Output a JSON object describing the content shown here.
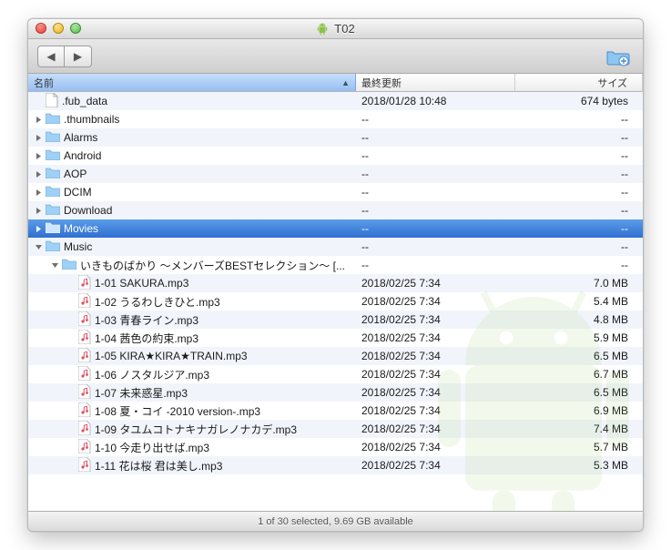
{
  "window": {
    "title": "T02"
  },
  "columns": {
    "name": "名前",
    "date": "最終更新",
    "size": "サイズ"
  },
  "status": "1 of 30 selected, 9.69 GB available",
  "rows": [
    {
      "indent": 0,
      "kind": "file",
      "expand": "",
      "name": ".fub_data",
      "date": "2018/01/28 10:48",
      "size": "674 bytes",
      "selected": false
    },
    {
      "indent": 0,
      "kind": "folder",
      "expand": "closed",
      "name": ".thumbnails",
      "date": "--",
      "size": "--",
      "selected": false
    },
    {
      "indent": 0,
      "kind": "folder",
      "expand": "closed",
      "name": "Alarms",
      "date": "--",
      "size": "--",
      "selected": false
    },
    {
      "indent": 0,
      "kind": "folder",
      "expand": "closed",
      "name": "Android",
      "date": "--",
      "size": "--",
      "selected": false
    },
    {
      "indent": 0,
      "kind": "folder",
      "expand": "closed",
      "name": "AOP",
      "date": "--",
      "size": "--",
      "selected": false
    },
    {
      "indent": 0,
      "kind": "folder",
      "expand": "closed",
      "name": "DCIM",
      "date": "--",
      "size": "--",
      "selected": false
    },
    {
      "indent": 0,
      "kind": "folder",
      "expand": "closed",
      "name": "Download",
      "date": "--",
      "size": "--",
      "selected": false
    },
    {
      "indent": 0,
      "kind": "folder",
      "expand": "closed",
      "name": "Movies",
      "date": "--",
      "size": "--",
      "selected": true
    },
    {
      "indent": 0,
      "kind": "folder",
      "expand": "open",
      "name": "Music",
      "date": "--",
      "size": "--",
      "selected": false
    },
    {
      "indent": 1,
      "kind": "folder",
      "expand": "open",
      "name": "いきものばかり ～メンバーズBESTセレクション～ [...",
      "date": "--",
      "size": "--",
      "selected": false
    },
    {
      "indent": 2,
      "kind": "music",
      "expand": "",
      "name": "1-01 SAKURA.mp3",
      "date": "2018/02/25 7:34",
      "size": "7.0 MB",
      "selected": false
    },
    {
      "indent": 2,
      "kind": "music",
      "expand": "",
      "name": "1-02 うるわしきひと.mp3",
      "date": "2018/02/25 7:34",
      "size": "5.4 MB",
      "selected": false
    },
    {
      "indent": 2,
      "kind": "music",
      "expand": "",
      "name": "1-03 青春ライン.mp3",
      "date": "2018/02/25 7:34",
      "size": "4.8 MB",
      "selected": false
    },
    {
      "indent": 2,
      "kind": "music",
      "expand": "",
      "name": "1-04 茜色の約束.mp3",
      "date": "2018/02/25 7:34",
      "size": "5.9 MB",
      "selected": false
    },
    {
      "indent": 2,
      "kind": "music",
      "expand": "",
      "name": "1-05 KIRA★KIRA★TRAIN.mp3",
      "date": "2018/02/25 7:34",
      "size": "6.5 MB",
      "selected": false
    },
    {
      "indent": 2,
      "kind": "music",
      "expand": "",
      "name": "1-06 ノスタルジア.mp3",
      "date": "2018/02/25 7:34",
      "size": "6.7 MB",
      "selected": false
    },
    {
      "indent": 2,
      "kind": "music",
      "expand": "",
      "name": "1-07 未来惑星.mp3",
      "date": "2018/02/25 7:34",
      "size": "6.5 MB",
      "selected": false
    },
    {
      "indent": 2,
      "kind": "music",
      "expand": "",
      "name": "1-08 夏・コイ -2010 version-.mp3",
      "date": "2018/02/25 7:34",
      "size": "6.9 MB",
      "selected": false
    },
    {
      "indent": 2,
      "kind": "music",
      "expand": "",
      "name": "1-09 タユムコトナキナガレノナカデ.mp3",
      "date": "2018/02/25 7:34",
      "size": "7.4 MB",
      "selected": false
    },
    {
      "indent": 2,
      "kind": "music",
      "expand": "",
      "name": "1-10 今走り出せば.mp3",
      "date": "2018/02/25 7:34",
      "size": "5.7 MB",
      "selected": false
    },
    {
      "indent": 2,
      "kind": "music",
      "expand": "",
      "name": "1-11 花は桜 君は美し.mp3",
      "date": "2018/02/25 7:34",
      "size": "5.3 MB",
      "selected": false
    }
  ]
}
